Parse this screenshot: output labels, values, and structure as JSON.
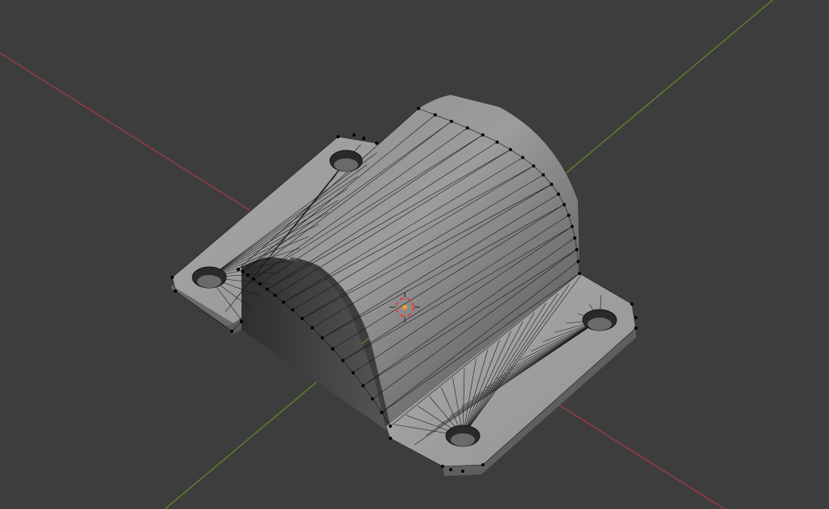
{
  "viewport": {
    "background": "#3d3d3d",
    "mode": "edit-mode-wireframe-overlay"
  },
  "axes": [
    {
      "name": "x-axis",
      "color": "#a33a44"
    },
    {
      "name": "y-axis",
      "color": "#5f8a2a"
    }
  ],
  "object": {
    "name": "pipe-clamp-mesh",
    "face_color": "#9a9a9a",
    "edge_color": "#1a1a1a",
    "vertex_color": "#000000",
    "mounting_holes": 4
  },
  "gizmo": {
    "name": "3d-cursor",
    "ring_colors": [
      "#e04040",
      "#f0f0f0"
    ],
    "origin_color": "#f0a020"
  }
}
